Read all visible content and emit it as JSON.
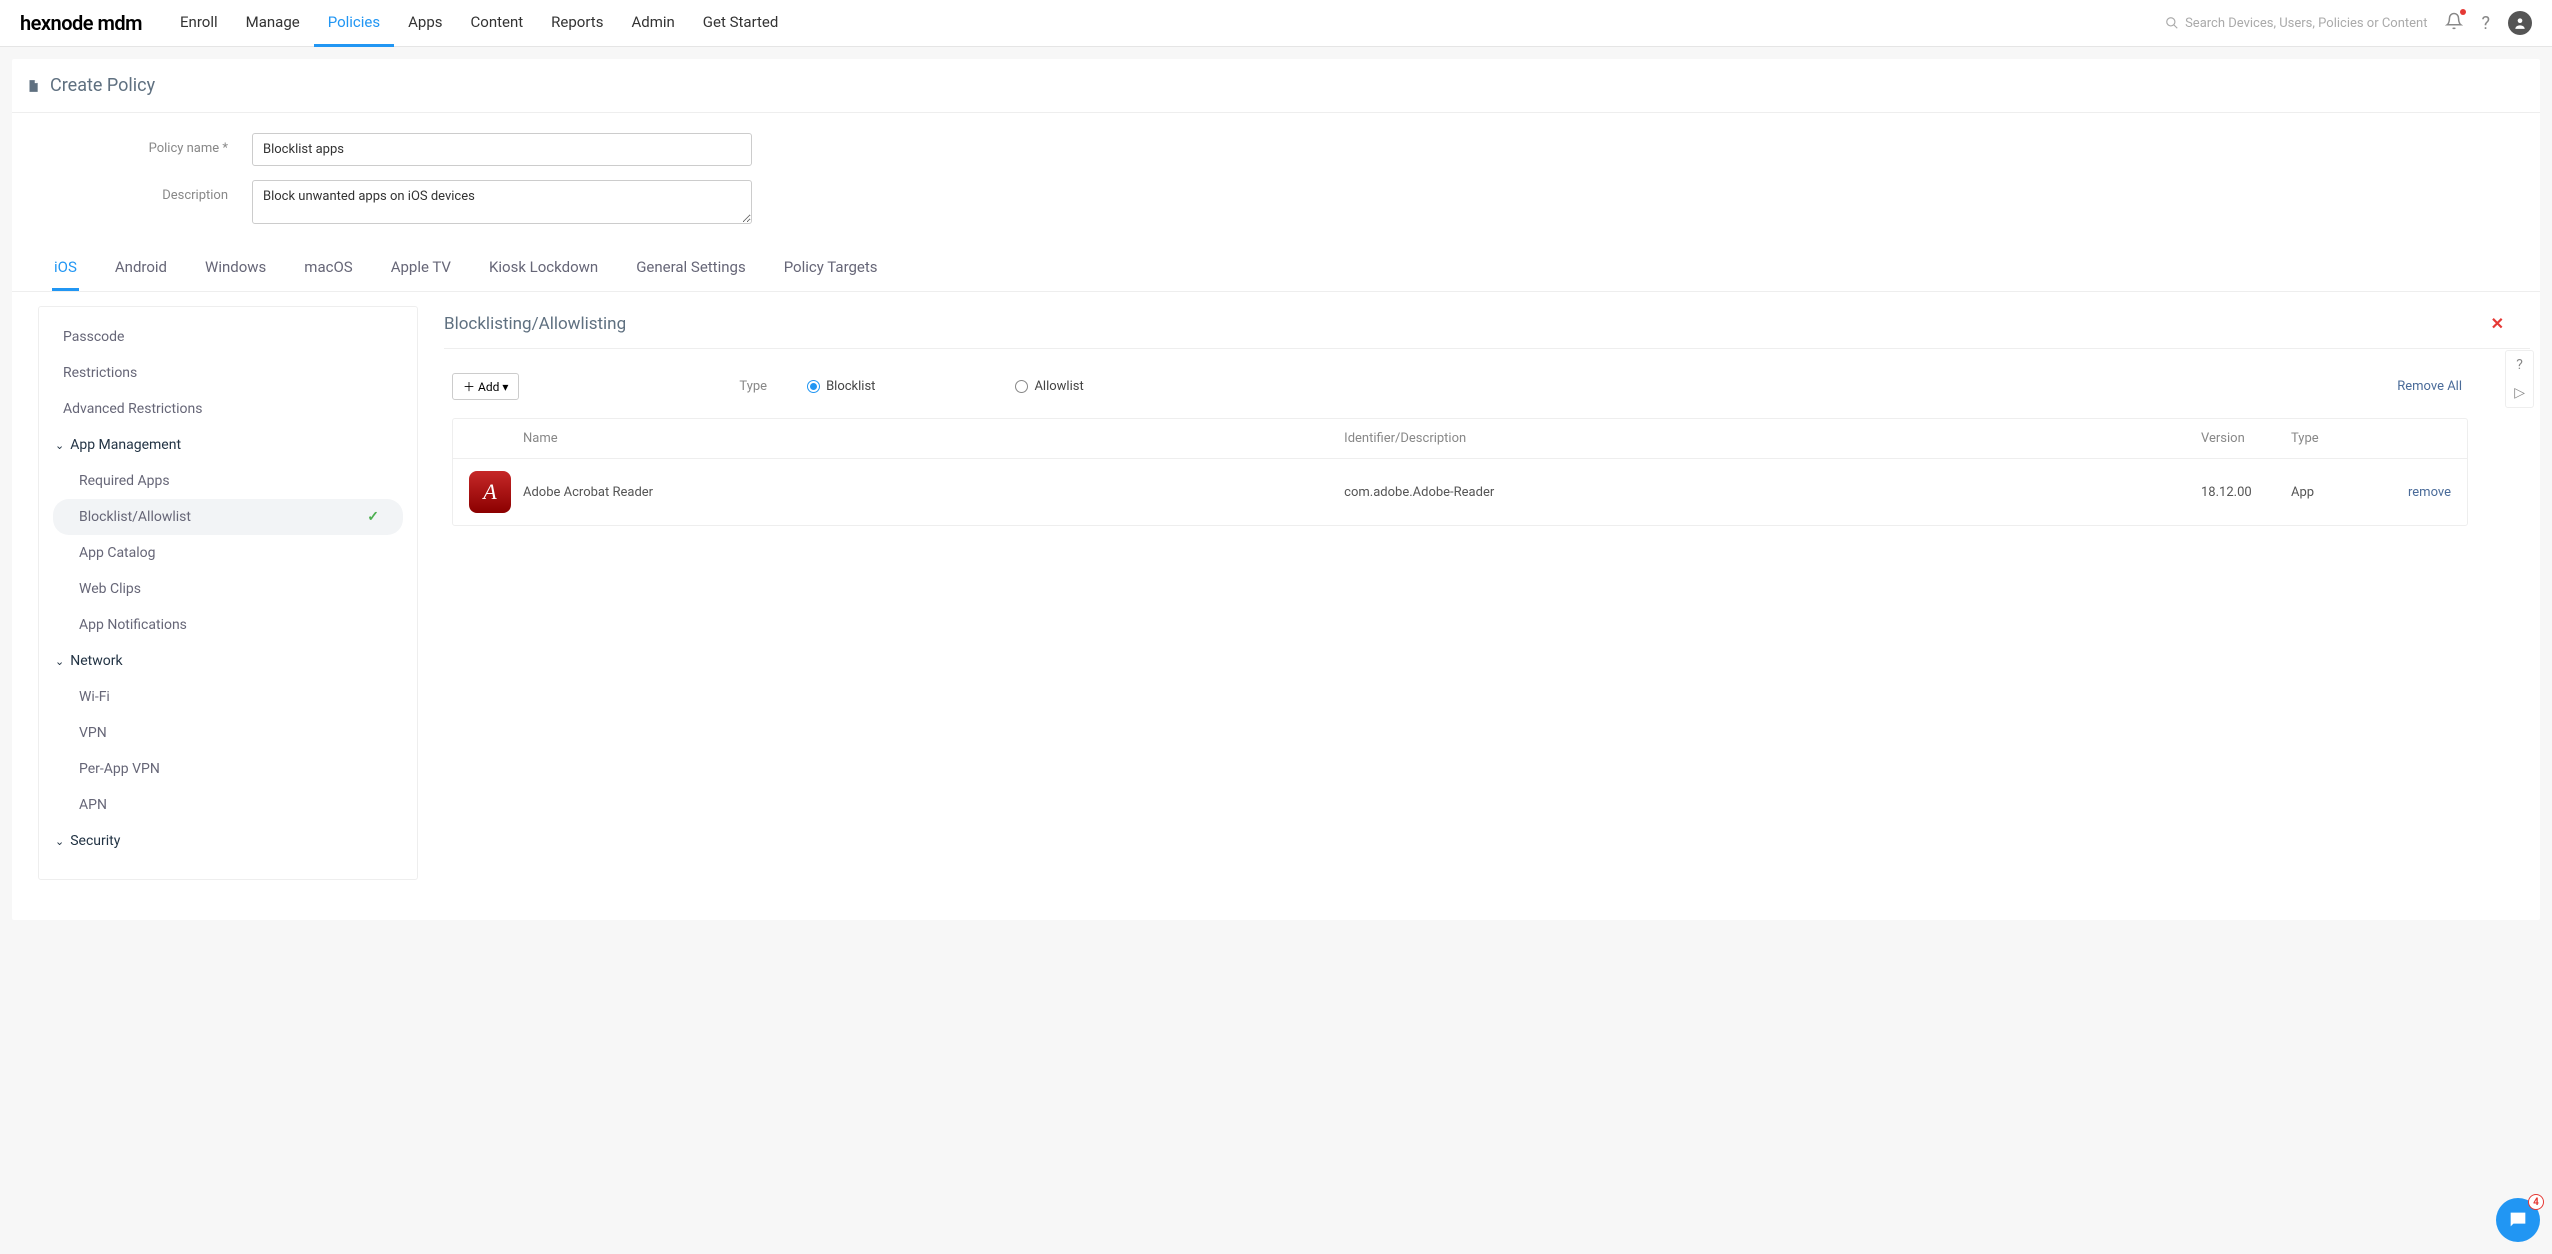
{
  "brand": "hexnode mdm",
  "topnav": [
    "Enroll",
    "Manage",
    "Policies",
    "Apps",
    "Content",
    "Reports",
    "Admin",
    "Get Started"
  ],
  "topnav_active_index": 2,
  "search_placeholder": "Search Devices, Users, Policies or Content",
  "page_title": "Create Policy",
  "form": {
    "name_label": "Policy name *",
    "name_value": "Blocklist apps",
    "desc_label": "Description",
    "desc_value": "Block unwanted apps on iOS devices"
  },
  "subtabs": [
    "iOS",
    "Android",
    "Windows",
    "macOS",
    "Apple TV",
    "Kiosk Lockdown",
    "General Settings",
    "Policy Targets"
  ],
  "subtabs_active_index": 0,
  "sidebar": {
    "top_items": [
      "Passcode",
      "Restrictions",
      "Advanced Restrictions"
    ],
    "sections": [
      {
        "name": "App Management",
        "items": [
          "Required Apps",
          "Blocklist/Allowlist",
          "App Catalog",
          "Web Clips",
          "App Notifications"
        ],
        "active_index": 1
      },
      {
        "name": "Network",
        "items": [
          "Wi-Fi",
          "VPN",
          "Per-App VPN",
          "APN"
        ],
        "active_index": -1
      },
      {
        "name": "Security",
        "items": [],
        "active_index": -1
      }
    ]
  },
  "panel": {
    "title": "Blocklisting/Allowlisting",
    "add_button": "Add",
    "type_label": "Type",
    "radio_options": [
      "Blocklist",
      "Allowlist"
    ],
    "radio_selected_index": 0,
    "remove_all": "Remove All",
    "columns": [
      "Name",
      "Identifier/Description",
      "Version",
      "Type"
    ],
    "rows": [
      {
        "name": "Adobe Acrobat Reader",
        "identifier": "com.adobe.Adobe-Reader",
        "version": "18.12.00",
        "type": "App",
        "remove_label": "remove",
        "icon_letter": "A"
      }
    ]
  },
  "chat_badge": "4"
}
